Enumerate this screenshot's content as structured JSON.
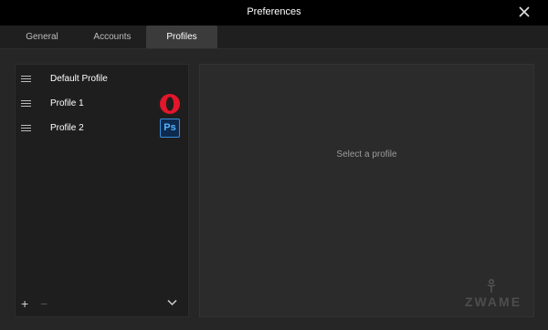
{
  "window": {
    "title": "Preferences"
  },
  "tabs": [
    {
      "label": "General"
    },
    {
      "label": "Accounts"
    },
    {
      "label": "Profiles"
    }
  ],
  "active_tab": "Profiles",
  "profiles": {
    "items": [
      {
        "label": "Default Profile",
        "icon": ""
      },
      {
        "label": "Profile 1",
        "icon": "opera-icon"
      },
      {
        "label": "Profile 2",
        "icon": "photoshop-icon",
        "icon_text": "Ps"
      }
    ],
    "add_label": "+",
    "remove_label": "−",
    "more_icon": "chevron-down-icon"
  },
  "detail": {
    "placeholder": "Select a profile"
  },
  "watermark": {
    "text": "ZWAME"
  },
  "colors": {
    "titlebar": "#000000",
    "background": "#262626",
    "active_tab": "#3b3b3b",
    "opera_red": "#e3162a",
    "photoshop_blue": "#3a8edb"
  }
}
